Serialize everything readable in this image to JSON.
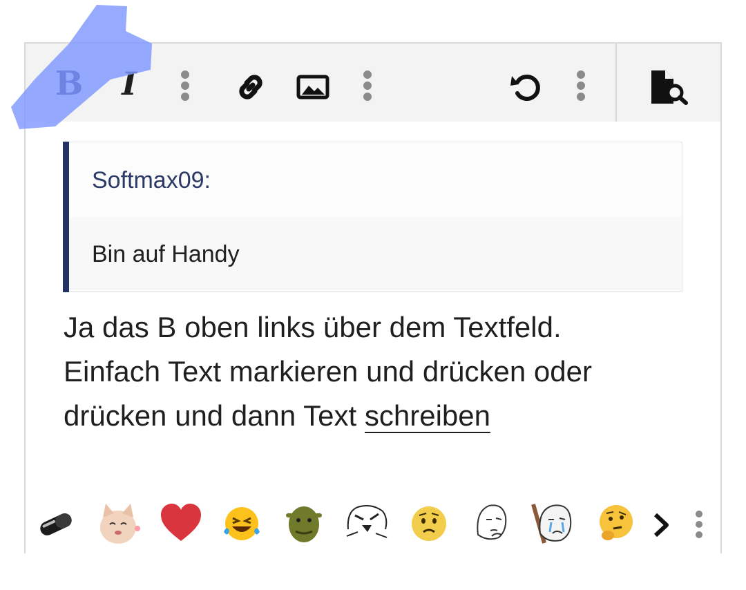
{
  "toolbar": {
    "bold_glyph": "B",
    "italic_glyph": "I",
    "buttons": [
      "bold",
      "italic",
      "more-text",
      "link",
      "image",
      "more-insert",
      "undo",
      "more-actions",
      "preview"
    ]
  },
  "quote": {
    "author": "Softmax09:",
    "text": "Bin auf Handy"
  },
  "message": {
    "line1": "Ja das B oben links über dem Textfeld.",
    "line2": "Einfach Text markieren und drücken oder",
    "line3_prefix": "drücken und dann Text ",
    "line3_underlined": "schreiben"
  },
  "smilies": [
    "pill",
    "cat",
    "heart",
    "laughing-crying",
    "shrek",
    "rage-face",
    "worried-face",
    "wojak-thinking",
    "crying-wojak",
    "thinking-face"
  ],
  "colors": {
    "accent": "#1e2a6a",
    "quote_bar": "#223263",
    "highlight": "#7f98ff"
  }
}
